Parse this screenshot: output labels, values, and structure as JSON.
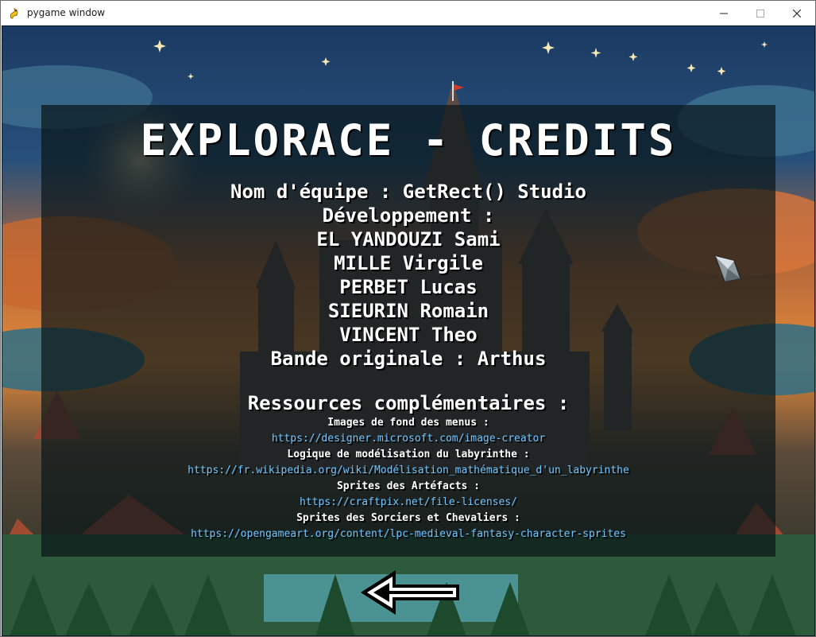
{
  "window": {
    "title": "pygame window"
  },
  "credits": {
    "title": "EXPLORACE - CREDITS",
    "team": "Nom d'équipe : GetRect() Studio",
    "dev_heading": "Développement :",
    "developers": [
      "EL YANDOUZI Sami",
      "MILLE Virgile",
      "PERBET Lucas",
      "SIEURIN Romain",
      "VINCENT Theo"
    ],
    "music": "Bande originale : Arthus",
    "resources_heading": "Ressources complémentaires :",
    "resources": [
      {
        "label": "Images de fond des menus :",
        "url": "https://designer.microsoft.com/image-creator"
      },
      {
        "label": "Logique de modélisation du labyrinthe :",
        "url": "https://fr.wikipedia.org/wiki/Modélisation_mathématique_d'un_labyrinthe"
      },
      {
        "label": "Sprites des Artéfacts :",
        "url": "https://craftpix.net/file-licenses/"
      },
      {
        "label": "Sprites des Sorciers et Chevaliers :",
        "url": "https://opengameart.org/content/lpc-medieval-fantasy-character-sprites"
      }
    ]
  },
  "colors": {
    "link": "#6ec3ff",
    "text": "#ffffff"
  },
  "icons": {
    "back": "back-arrow-icon",
    "cursor": "cursor-icon",
    "app": "pygame-snake-icon"
  }
}
